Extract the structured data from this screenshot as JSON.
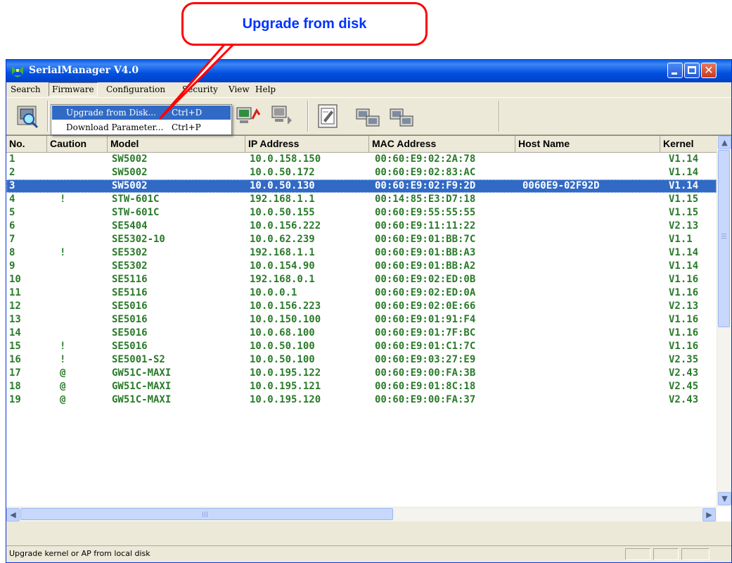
{
  "callout": {
    "text": "Upgrade from disk"
  },
  "window": {
    "title": "SerialManager V4.0",
    "icon": "serial-manager-icon",
    "controls": [
      "minimize-icon",
      "maximize-icon",
      "close-icon"
    ]
  },
  "menubar": {
    "search": "Search",
    "firmware": "Firmware",
    "configuration": "Configuration",
    "security": "Security",
    "view": "View",
    "help": "Help"
  },
  "dropdown": {
    "items": [
      {
        "label": "Upgrade from Disk...",
        "shortcut": "Ctrl+D"
      },
      {
        "label": "Download Parameter...",
        "shortcut": "Ctrl+P"
      }
    ]
  },
  "toolbar": {
    "icons": [
      "search-device-icon",
      "upgrade-firmware-icon",
      "download-parameter-icon",
      "configuration-icon",
      "export-icon",
      "import-icon"
    ]
  },
  "table": {
    "columns": [
      "No.",
      "Caution",
      "Model",
      "IP Address",
      "MAC Address",
      "Host Name",
      "Kernel"
    ],
    "rows": [
      [
        "1",
        "",
        "SW5002",
        "10.0.158.150",
        "00:60:E9:02:2A:78",
        "",
        "V1.14"
      ],
      [
        "2",
        "",
        "SW5002",
        "10.0.50.172",
        "00:60:E9:02:83:AC",
        "",
        "V1.14"
      ],
      [
        "3",
        "",
        "SW5002",
        "10.0.50.130",
        "00:60:E9:02:F9:2D",
        "0060E9-02F92D",
        "V1.14"
      ],
      [
        "4",
        "!",
        "STW-601C",
        "192.168.1.1",
        "00:14:85:E3:D7:18",
        "",
        "V1.15"
      ],
      [
        "5",
        "",
        "STW-601C",
        "10.0.50.155",
        "00:60:E9:55:55:55",
        "",
        "V1.15"
      ],
      [
        "6",
        "",
        "SE5404",
        "10.0.156.222",
        "00:60:E9:11:11:22",
        "",
        "V2.13"
      ],
      [
        "7",
        "",
        "SE5302-10",
        "10.0.62.239",
        "00:60:E9:01:BB:7C",
        "",
        "V1.1"
      ],
      [
        "8",
        "!",
        "SE5302",
        "192.168.1.1",
        "00:60:E9:01:BB:A3",
        "",
        "V1.14"
      ],
      [
        "9",
        "",
        "SE5302",
        "10.0.154.90",
        "00:60:E9:01:BB:A2",
        "",
        "V1.14"
      ],
      [
        "10",
        "",
        "SE5116",
        "192.168.0.1",
        "00:60:E9:02:ED:0B",
        "",
        "V1.16"
      ],
      [
        "11",
        "",
        "SE5116",
        "10.0.0.1",
        "00:60:E9:02:ED:0A",
        "",
        "V1.16"
      ],
      [
        "12",
        "",
        "SE5016",
        "10.0.156.223",
        "00:60:E9:02:0E:66",
        "",
        "V2.13"
      ],
      [
        "13",
        "",
        "SE5016",
        "10.0.150.100",
        "00:60:E9:01:91:F4",
        "",
        "V1.16"
      ],
      [
        "14",
        "",
        "SE5016",
        "10.0.68.100",
        "00:60:E9:01:7F:BC",
        "",
        "V1.16"
      ],
      [
        "15",
        "!",
        "SE5016",
        "10.0.50.100",
        "00:60:E9:01:C1:7C",
        "",
        "V1.16"
      ],
      [
        "16",
        "!",
        "SE5001-S2",
        "10.0.50.100",
        "00:60:E9:03:27:E9",
        "",
        "V2.35"
      ],
      [
        "17",
        "@",
        "GW51C-MAXI",
        "10.0.195.122",
        "00:60:E9:00:FA:3B",
        "",
        "V2.43"
      ],
      [
        "18",
        "@",
        "GW51C-MAXI",
        "10.0.195.121",
        "00:60:E9:01:8C:18",
        "",
        "V2.45"
      ],
      [
        "19",
        "@",
        "GW51C-MAXI",
        "10.0.195.120",
        "00:60:E9:00:FA:37",
        "",
        "V2.43"
      ]
    ],
    "selected_row": 3
  },
  "status": {
    "text": "Upgrade kernel or AP from local disk"
  },
  "colors": {
    "callout_border": "#ff0000",
    "callout_text": "#0033ff",
    "row_text": "#2a7a2a",
    "selection": "#316ac5",
    "titlebar": "#0a5fe3"
  }
}
